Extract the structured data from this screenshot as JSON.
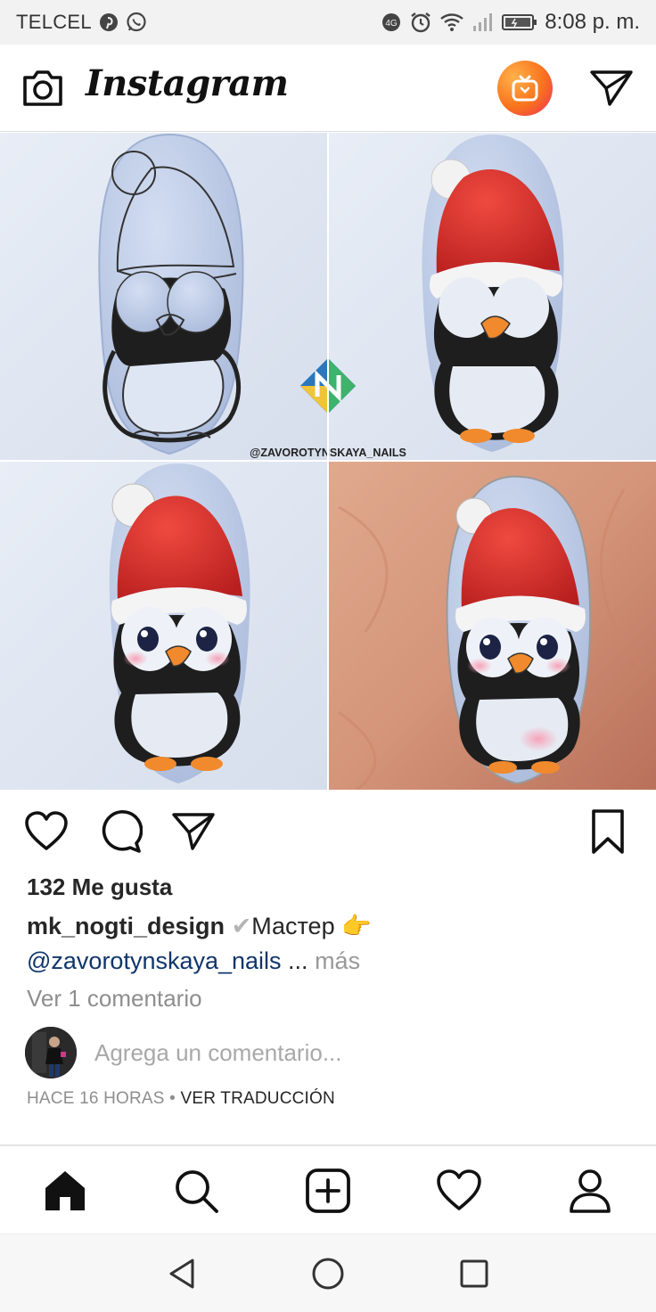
{
  "status_bar": {
    "carrier": "TELCEL",
    "time": "8:08 p. m.",
    "icons": [
      "pinterest-icon",
      "whatsapp-icon",
      "data-icon",
      "alarm-icon",
      "wifi-icon",
      "signal-icon",
      "battery-icon"
    ]
  },
  "header": {
    "logo": "Instagram",
    "icons": [
      "camera-icon",
      "igtv-icon",
      "direct-send-icon"
    ]
  },
  "post": {
    "watermark": "@ZAVOROTYNSKAYA_NAILS",
    "actions": [
      "heart-icon",
      "comment-icon",
      "share-icon",
      "bookmark-icon"
    ],
    "likes": "132 Me gusta",
    "caption": {
      "username": "mk_nogti_design",
      "check": "✔",
      "text": "Мастер",
      "emoji": "👉",
      "mention": "@zavorotynskaya_nails",
      "ellipsis": " ...",
      "more": " más"
    },
    "view_comments": "Ver 1 comentario",
    "comment_placeholder": "Agrega un comentario...",
    "timestamp": "HACE 16 HORAS",
    "separator": " • ",
    "translate": "VER TRADUCCIÓN"
  },
  "tab_bar": {
    "items": [
      "home-icon",
      "search-icon",
      "new-post-icon",
      "activity-icon",
      "profile-icon"
    ]
  },
  "android_nav": {
    "items": [
      "back-icon",
      "home-circle-icon",
      "recents-icon"
    ]
  },
  "colors": {
    "hat_red": "#d9302c",
    "nail_blue": "#b9c8e6",
    "beak_orange": "#f08a2c",
    "mention_blue": "#10356b",
    "muted_gray": "#8e8e8e"
  }
}
